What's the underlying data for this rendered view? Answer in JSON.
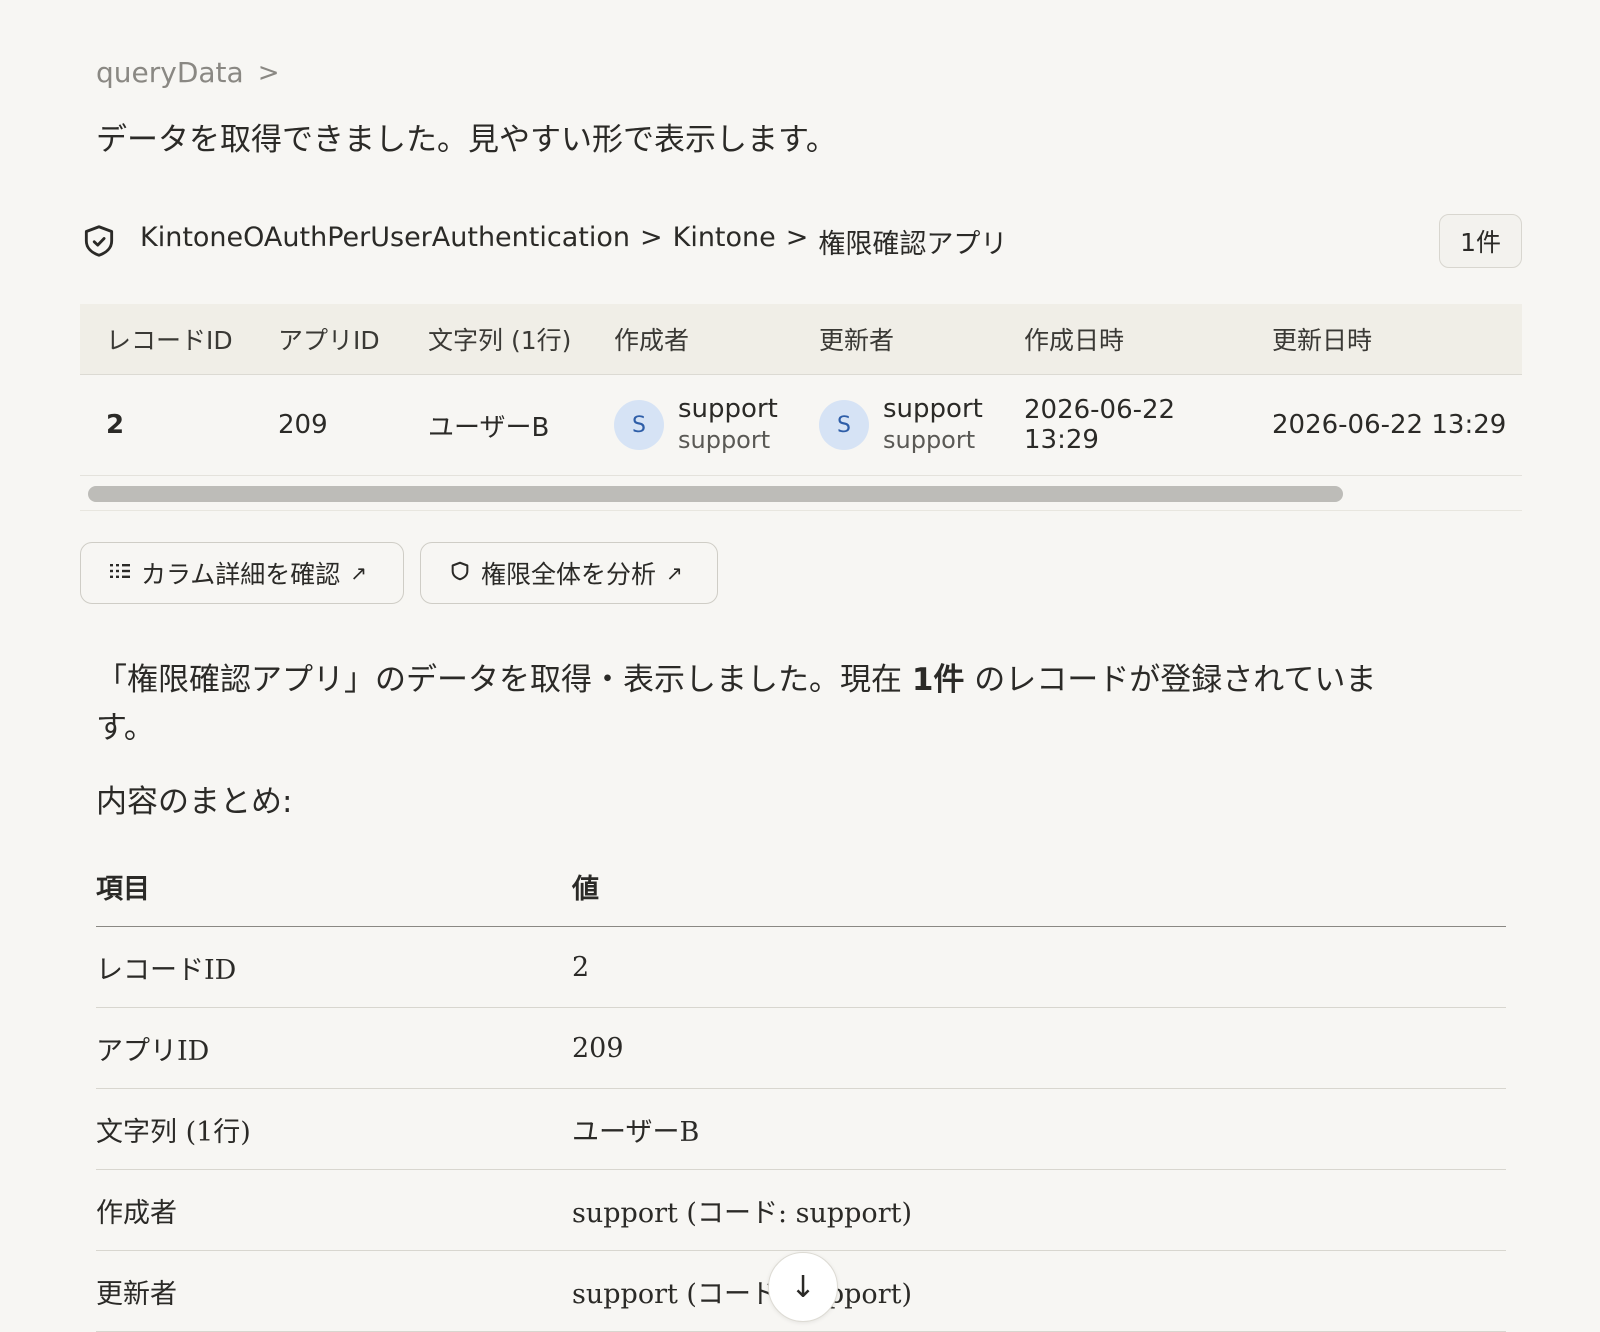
{
  "tool": {
    "label": "queryData",
    "chevron": ">"
  },
  "intro": "データを取得できました。見やすい形で表示します。",
  "artifact": {
    "breadcrumb": [
      "KintoneOAuthPerUserAuthentication",
      "Kintone",
      "権限確認アプリ"
    ],
    "breadcrumb_sep": ">",
    "count": "1件",
    "columns": [
      "レコードID",
      "アプリID",
      "文字列 (1行)",
      "作成者",
      "更新者",
      "作成日時",
      "更新日時"
    ],
    "row": {
      "record_id": "2",
      "app_id": "209",
      "text": "ユーザーB",
      "creator": {
        "initial": "S",
        "name": "support",
        "code": "support"
      },
      "modifier": {
        "initial": "S",
        "name": "support",
        "code": "support"
      },
      "created": "2026-06-22 13:29",
      "updated": "2026-06-22 13:29"
    },
    "scroll_fraction": 0.88
  },
  "actions": {
    "columns_label": "カラム詳細を確認",
    "analyze_label": "権限全体を分析",
    "arrow": "↗"
  },
  "summary": {
    "prefix": "「権限確認アプリ」のデータを取得・表示しました。現在",
    "count": "1件",
    "suffix": "のレコードが登録されています。",
    "heading": "内容のまとめ:"
  },
  "kv": {
    "headers": [
      "項目",
      "値"
    ],
    "rows": [
      [
        "レコードID",
        "2"
      ],
      [
        "アプリID",
        "209"
      ],
      [
        "文字列 (1行)",
        "ユーザーB"
      ],
      [
        "作成者",
        "support (コード: support)"
      ],
      [
        "更新者",
        "support (コード: support)"
      ]
    ]
  },
  "colors": {
    "avatar_bg": "#d6e3f5",
    "avatar_fg": "#2e5ea8",
    "background": "#f7f6f3"
  }
}
